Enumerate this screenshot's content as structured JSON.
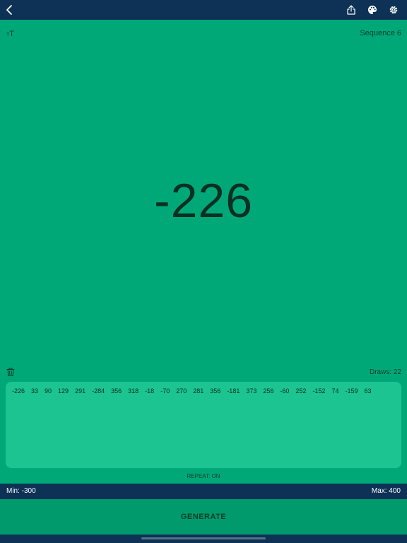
{
  "toolbar": {
    "back_icon": "chevron-left-icon",
    "share_icon": "share-icon",
    "palette_icon": "palette-icon",
    "settings_icon": "gear-icon"
  },
  "display": {
    "font_size_icon": "font-size-icon",
    "sequence_label": "Sequence 6",
    "current_number": "-226"
  },
  "history": {
    "clear_icon": "trash-icon",
    "draws_label": "Draws: 22",
    "values": [
      "-226",
      "33",
      "90",
      "129",
      "291",
      "-284",
      "356",
      "318",
      "-18",
      "-70",
      "270",
      "281",
      "356",
      "-181",
      "373",
      "256",
      "-60",
      "252",
      "-152",
      "74",
      "-159",
      "63"
    ],
    "repeat_label": "REPEAT: ON"
  },
  "range": {
    "min_label": "Min: -300",
    "max_label": "Max: 400"
  },
  "actions": {
    "generate_label": "GENERATE"
  },
  "colors": {
    "background": "#00a878",
    "history_box": "#1bc490",
    "bars": "#0e3256",
    "generate_button": "#009a6c"
  }
}
